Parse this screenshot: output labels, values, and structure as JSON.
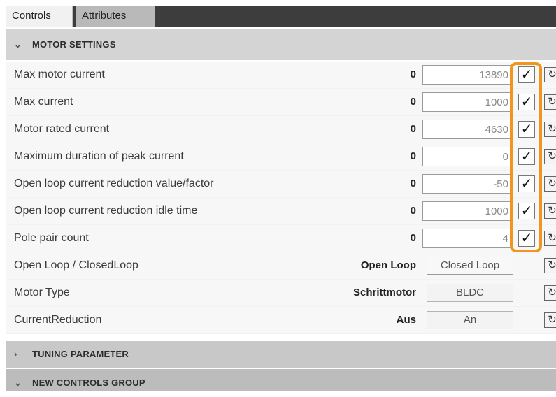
{
  "tabs": [
    {
      "label": "Controls",
      "active": true
    },
    {
      "label": "Attributes",
      "active": false
    }
  ],
  "groups": {
    "motor": {
      "title": "MOTOR SETTINGS",
      "expanded": true
    },
    "tuning": {
      "title": "TUNING PARAMETER",
      "expanded": false
    },
    "new": {
      "title": "NEW CONTROLS GROUP",
      "expanded": true
    }
  },
  "rows": [
    {
      "label": "Max motor current",
      "current": "0",
      "value": "13890",
      "checked": true
    },
    {
      "label": "Max current",
      "current": "0",
      "value": "1000",
      "checked": true
    },
    {
      "label": "Motor rated current",
      "current": "0",
      "value": "4630",
      "checked": true
    },
    {
      "label": "Maximum duration of peak current",
      "current": "0",
      "value": "0",
      "checked": true
    },
    {
      "label": "Open loop current reduction value/factor",
      "current": "0",
      "value": "-50",
      "checked": true
    },
    {
      "label": "Open loop current reduction idle time",
      "current": "0",
      "value": "1000",
      "checked": true
    },
    {
      "label": "Pole pair count",
      "current": "0",
      "value": "4",
      "checked": true
    },
    {
      "label": "Open Loop / ClosedLoop",
      "current": "Open Loop",
      "option": "Closed Loop"
    },
    {
      "label": "Motor Type",
      "current": "Schrittmotor",
      "option": "BLDC"
    },
    {
      "label": "CurrentReduction",
      "current": "Aus",
      "option": "An"
    }
  ],
  "colors": {
    "highlight": "#f0961e",
    "tabbar": "#3d3d3d",
    "group_header": "#d4d4d4"
  },
  "icons": {
    "collapse": "chevron-down-icon",
    "expand": "chevron-right-icon",
    "checkmark": "check-icon",
    "refresh": "refresh-icon"
  }
}
